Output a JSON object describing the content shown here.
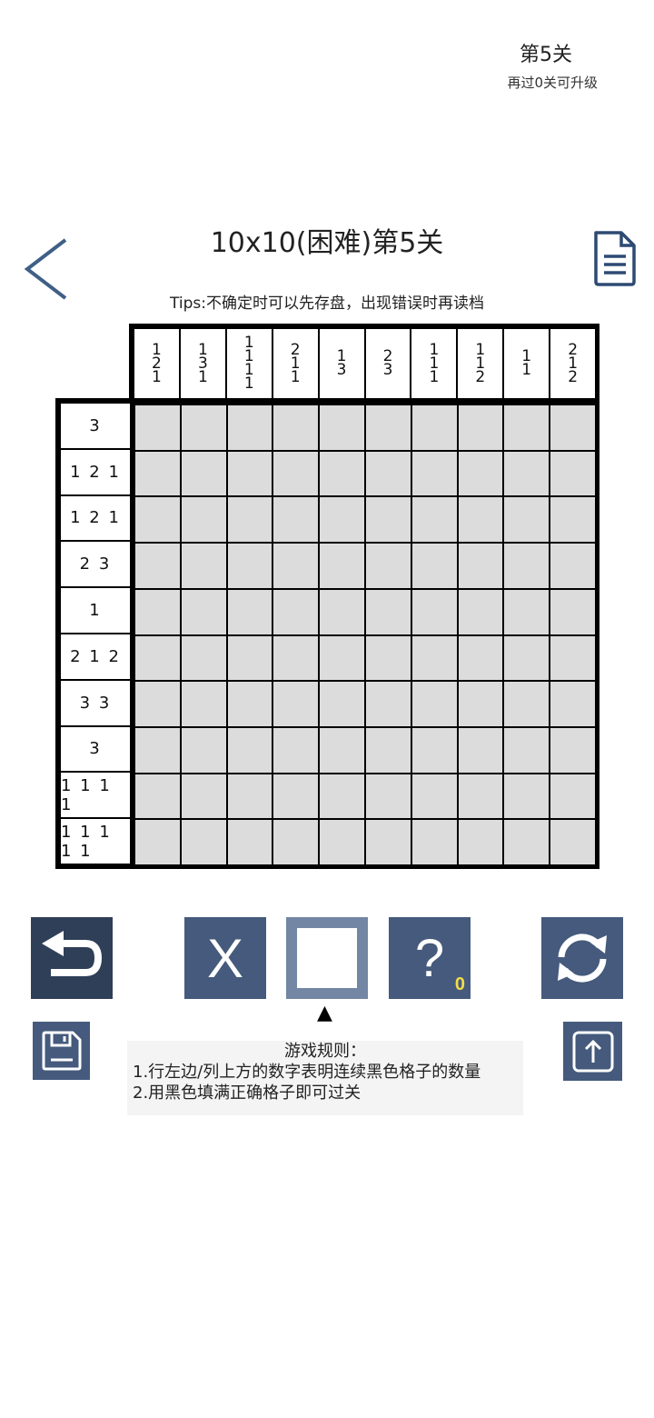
{
  "level": {
    "title": "第5关",
    "subtitle": "再过0关可升级"
  },
  "header": {
    "back_icon": "chevron-left-icon",
    "title": "10x10(困难)第5关",
    "doc_icon": "document-icon",
    "tips": "Tips:不确定时可以先存盘，出现错误时再读档"
  },
  "puzzle": {
    "size": 10,
    "col_clues": [
      [
        "1",
        "2",
        "1"
      ],
      [
        "1",
        "3",
        "1"
      ],
      [
        "1",
        "1",
        "1",
        "1"
      ],
      [
        "2",
        "1",
        "1"
      ],
      [
        "1",
        "3"
      ],
      [
        "2",
        "3"
      ],
      [
        "1",
        "1",
        "1"
      ],
      [
        "1",
        "1",
        "2"
      ],
      [
        "1",
        "1"
      ],
      [
        "2",
        "1",
        "2"
      ]
    ],
    "row_clues": [
      "3",
      "1 2 1",
      "1 2 1",
      "2 3",
      "1",
      "2 1 2",
      "3 3",
      "3",
      "1 1 1 1",
      "1 1 1 1 1"
    ]
  },
  "toolbar": {
    "undo_icon": "undo-icon",
    "cross_label": "X",
    "fill_icon": "fill-square-icon",
    "hint_label": "?",
    "hint_count": "0",
    "reset_icon": "refresh-icon",
    "indicator": "▲",
    "save_icon": "save-icon",
    "share_icon": "upload-icon"
  },
  "rules": {
    "title": "游戏规则：",
    "line1": "1.行左边/列上方的数字表明连续黑色格子的数量",
    "line2": "2.用黑色填满正确格子即可过关"
  },
  "colors": {
    "button": "#455a7c",
    "button_dark": "#2f3f58",
    "button_light": "#7386a4",
    "cell": "#dcdcdc",
    "hint_count": "#f3dc4a"
  }
}
